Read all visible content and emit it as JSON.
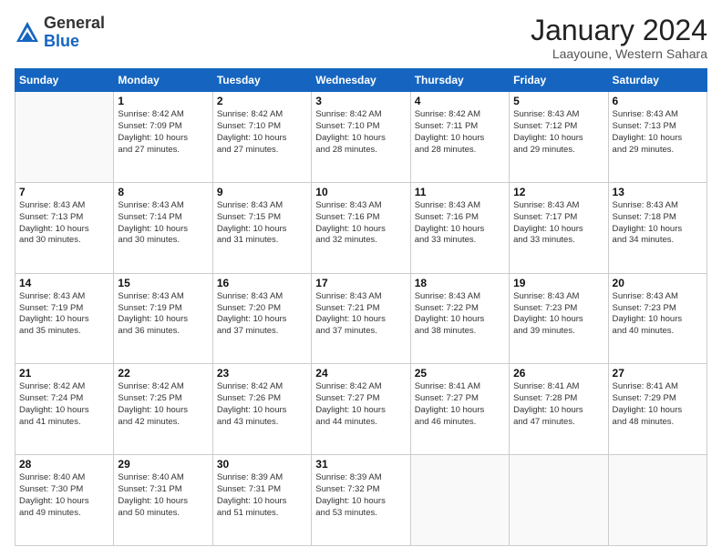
{
  "logo": {
    "general": "General",
    "blue": "Blue"
  },
  "header": {
    "month_year": "January 2024",
    "location": "Laayoune, Western Sahara"
  },
  "days_of_week": [
    "Sunday",
    "Monday",
    "Tuesday",
    "Wednesday",
    "Thursday",
    "Friday",
    "Saturday"
  ],
  "weeks": [
    [
      {
        "day": "",
        "info": ""
      },
      {
        "day": "1",
        "info": "Sunrise: 8:42 AM\nSunset: 7:09 PM\nDaylight: 10 hours\nand 27 minutes."
      },
      {
        "day": "2",
        "info": "Sunrise: 8:42 AM\nSunset: 7:10 PM\nDaylight: 10 hours\nand 27 minutes."
      },
      {
        "day": "3",
        "info": "Sunrise: 8:42 AM\nSunset: 7:10 PM\nDaylight: 10 hours\nand 28 minutes."
      },
      {
        "day": "4",
        "info": "Sunrise: 8:42 AM\nSunset: 7:11 PM\nDaylight: 10 hours\nand 28 minutes."
      },
      {
        "day": "5",
        "info": "Sunrise: 8:43 AM\nSunset: 7:12 PM\nDaylight: 10 hours\nand 29 minutes."
      },
      {
        "day": "6",
        "info": "Sunrise: 8:43 AM\nSunset: 7:13 PM\nDaylight: 10 hours\nand 29 minutes."
      }
    ],
    [
      {
        "day": "7",
        "info": "Sunrise: 8:43 AM\nSunset: 7:13 PM\nDaylight: 10 hours\nand 30 minutes."
      },
      {
        "day": "8",
        "info": "Sunrise: 8:43 AM\nSunset: 7:14 PM\nDaylight: 10 hours\nand 30 minutes."
      },
      {
        "day": "9",
        "info": "Sunrise: 8:43 AM\nSunset: 7:15 PM\nDaylight: 10 hours\nand 31 minutes."
      },
      {
        "day": "10",
        "info": "Sunrise: 8:43 AM\nSunset: 7:16 PM\nDaylight: 10 hours\nand 32 minutes."
      },
      {
        "day": "11",
        "info": "Sunrise: 8:43 AM\nSunset: 7:16 PM\nDaylight: 10 hours\nand 33 minutes."
      },
      {
        "day": "12",
        "info": "Sunrise: 8:43 AM\nSunset: 7:17 PM\nDaylight: 10 hours\nand 33 minutes."
      },
      {
        "day": "13",
        "info": "Sunrise: 8:43 AM\nSunset: 7:18 PM\nDaylight: 10 hours\nand 34 minutes."
      }
    ],
    [
      {
        "day": "14",
        "info": "Sunrise: 8:43 AM\nSunset: 7:19 PM\nDaylight: 10 hours\nand 35 minutes."
      },
      {
        "day": "15",
        "info": "Sunrise: 8:43 AM\nSunset: 7:19 PM\nDaylight: 10 hours\nand 36 minutes."
      },
      {
        "day": "16",
        "info": "Sunrise: 8:43 AM\nSunset: 7:20 PM\nDaylight: 10 hours\nand 37 minutes."
      },
      {
        "day": "17",
        "info": "Sunrise: 8:43 AM\nSunset: 7:21 PM\nDaylight: 10 hours\nand 37 minutes."
      },
      {
        "day": "18",
        "info": "Sunrise: 8:43 AM\nSunset: 7:22 PM\nDaylight: 10 hours\nand 38 minutes."
      },
      {
        "day": "19",
        "info": "Sunrise: 8:43 AM\nSunset: 7:23 PM\nDaylight: 10 hours\nand 39 minutes."
      },
      {
        "day": "20",
        "info": "Sunrise: 8:43 AM\nSunset: 7:23 PM\nDaylight: 10 hours\nand 40 minutes."
      }
    ],
    [
      {
        "day": "21",
        "info": "Sunrise: 8:42 AM\nSunset: 7:24 PM\nDaylight: 10 hours\nand 41 minutes."
      },
      {
        "day": "22",
        "info": "Sunrise: 8:42 AM\nSunset: 7:25 PM\nDaylight: 10 hours\nand 42 minutes."
      },
      {
        "day": "23",
        "info": "Sunrise: 8:42 AM\nSunset: 7:26 PM\nDaylight: 10 hours\nand 43 minutes."
      },
      {
        "day": "24",
        "info": "Sunrise: 8:42 AM\nSunset: 7:27 PM\nDaylight: 10 hours\nand 44 minutes."
      },
      {
        "day": "25",
        "info": "Sunrise: 8:41 AM\nSunset: 7:27 PM\nDaylight: 10 hours\nand 46 minutes."
      },
      {
        "day": "26",
        "info": "Sunrise: 8:41 AM\nSunset: 7:28 PM\nDaylight: 10 hours\nand 47 minutes."
      },
      {
        "day": "27",
        "info": "Sunrise: 8:41 AM\nSunset: 7:29 PM\nDaylight: 10 hours\nand 48 minutes."
      }
    ],
    [
      {
        "day": "28",
        "info": "Sunrise: 8:40 AM\nSunset: 7:30 PM\nDaylight: 10 hours\nand 49 minutes."
      },
      {
        "day": "29",
        "info": "Sunrise: 8:40 AM\nSunset: 7:31 PM\nDaylight: 10 hours\nand 50 minutes."
      },
      {
        "day": "30",
        "info": "Sunrise: 8:39 AM\nSunset: 7:31 PM\nDaylight: 10 hours\nand 51 minutes."
      },
      {
        "day": "31",
        "info": "Sunrise: 8:39 AM\nSunset: 7:32 PM\nDaylight: 10 hours\nand 53 minutes."
      },
      {
        "day": "",
        "info": ""
      },
      {
        "day": "",
        "info": ""
      },
      {
        "day": "",
        "info": ""
      }
    ]
  ]
}
